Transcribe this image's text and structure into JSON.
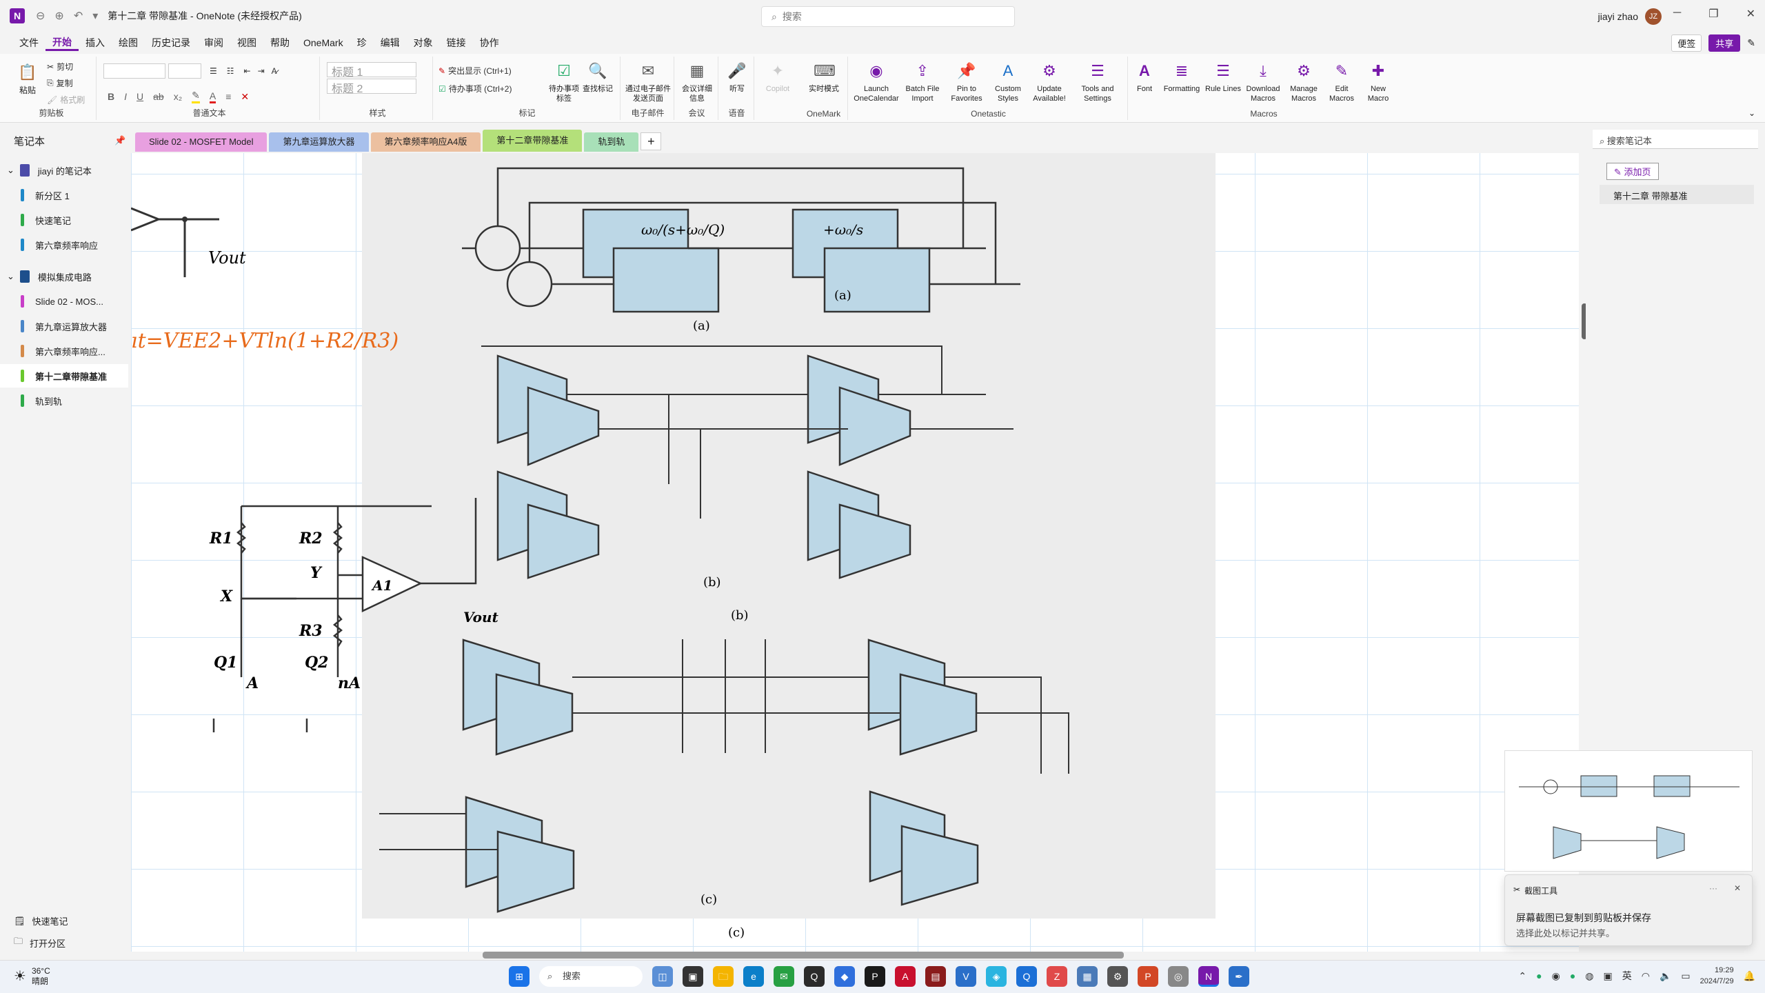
{
  "titlebar": {
    "title": "第十二章 带隙基准 - OneNote (未经授权产品)",
    "search_placeholder": "搜索",
    "user_name": "jiayi zhao",
    "user_initials": "JZ"
  },
  "menu": {
    "items": [
      "文件",
      "开始",
      "插入",
      "绘图",
      "历史记录",
      "审阅",
      "视图",
      "帮助",
      "OneMark",
      "珍",
      "编辑",
      "对象",
      "链接",
      "协作"
    ],
    "active_index": 1,
    "sticky": "便签",
    "share": "共享"
  },
  "ribbon": {
    "clipboard": {
      "paste": "粘贴",
      "cut": "剪切",
      "copy": "复制",
      "format_painter": "格式刷",
      "label": "剪贴板"
    },
    "basic_text": {
      "label": "普通文本"
    },
    "styles": {
      "h1": "标题 1",
      "h2": "标题 2",
      "label": "样式"
    },
    "tags": {
      "highlight": "突出显示 (Ctrl+1)",
      "todo": "待办事项 (Ctrl+2)",
      "todo_tag": "待办事项标签",
      "find_tags": "查找标记",
      "label": "标记"
    },
    "email": {
      "send": "通过电子邮件发送页面",
      "label": "电子邮件"
    },
    "meeting": {
      "details": "会议详细信息",
      "label": "会议"
    },
    "voice": {
      "dictate": "听写",
      "label": "语音"
    },
    "copilot": "Copilot",
    "onemark": {
      "realtime": "实时模式",
      "label": "OneMark"
    },
    "onetastic": {
      "label": "Onetastic",
      "buttons": [
        "Launch OneCalendar",
        "Batch File Import",
        "Pin to Favorites",
        "Custom Styles",
        "Update Available!",
        "Tools and Settings"
      ]
    },
    "macros": {
      "label": "Macros",
      "buttons": [
        "Font",
        "Formatting",
        "Rule Lines",
        "Download Macros",
        "Manage Macros",
        "Edit Macros",
        "New Macro"
      ]
    }
  },
  "left_panel": {
    "header": "笔记本",
    "notebooks": [
      {
        "name": "jiayi 的笔记本",
        "color": "#4b4ba8",
        "type": "book"
      },
      {
        "name": "新分区 1",
        "color": "#1e88c8",
        "type": "section"
      },
      {
        "name": "快速笔记",
        "color": "#2eaa4a",
        "type": "section"
      },
      {
        "name": "第六章频率响应",
        "color": "#1e88c8",
        "type": "section"
      },
      {
        "name": "模拟集成电路",
        "color": "#1e4f8c",
        "type": "book"
      },
      {
        "name": "Slide 02 - MOS...",
        "color": "#c83ec8",
        "type": "section"
      },
      {
        "name": "第九章运算放大器",
        "color": "#4a86c8",
        "type": "section"
      },
      {
        "name": "第六章频率响应...",
        "color": "#d48a4a",
        "type": "section"
      },
      {
        "name": "第十二章带隙基准",
        "color": "#6ac82e",
        "type": "section"
      },
      {
        "name": "轨到轨",
        "color": "#2eaa4a",
        "type": "section"
      }
    ],
    "selected_index": 8,
    "bottom_quick": "快速笔记",
    "bottom_open": "打开分区"
  },
  "tabs": [
    {
      "label": "Slide 02 - MOSFET Model",
      "color": "#e8a0e0"
    },
    {
      "label": "第九章运算放大器",
      "color": "#a8c0ec"
    },
    {
      "label": "第六章频率响应A4版",
      "color": "#ecc0a0"
    },
    {
      "label": "第十二章带隙基准",
      "color": "#b4e07a"
    },
    {
      "label": "轨到轨",
      "color": "#a8e0b8"
    }
  ],
  "active_tab": 3,
  "right_panel": {
    "search_placeholder": "搜索笔记本",
    "add_page": "添加页",
    "pages": [
      "第十二章 带隙基准"
    ]
  },
  "canvas": {
    "handwritten": "ıt=VEE2+VTln(1+R2/R3)",
    "left_circuit": {
      "r1": "R1",
      "r2": "R2",
      "r3": "R3",
      "q1": "Q1",
      "q2": "Q2",
      "x": "X",
      "y": "Y",
      "a1": "A1",
      "a": "A",
      "na": "nA",
      "vout": "Vout"
    },
    "figure_labels": [
      "(a)",
      "(a)",
      "(b)",
      "(b)",
      "(c)",
      "(c)"
    ]
  },
  "toast": {
    "app": "截图工具",
    "title": "屏幕截图已复制到剪贴板并保存",
    "body": "选择此处以标记并共享。"
  },
  "taskbar": {
    "weather_temp": "36°C",
    "weather_desc": "晴朗",
    "search": "搜索",
    "ime": "英",
    "time": "19:29",
    "date": "2024/7/29"
  }
}
